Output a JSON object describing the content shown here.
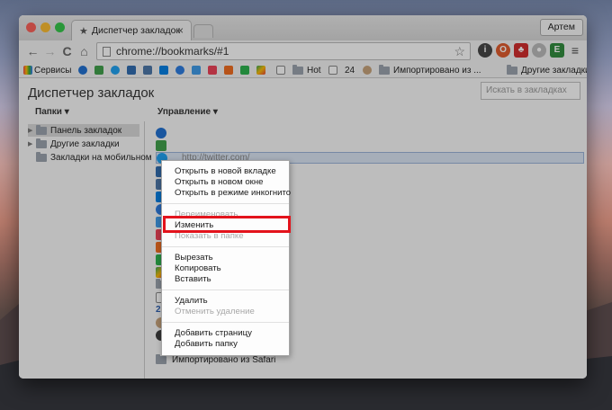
{
  "browser": {
    "tab_title": "Диспетчер закладок",
    "profile": "Артем",
    "url": "chrome://bookmarks/#1"
  },
  "bookmarks_bar": {
    "services": "Сервисы",
    "hot": "Hot",
    "num": "24",
    "imported": "Импортировано из ...",
    "other": "Другие закладки"
  },
  "page": {
    "title": "Диспетчер закладок",
    "search_placeholder": "Искать в закладках",
    "folders_header": "Папки ▾",
    "manage_header": "Управление ▾"
  },
  "tree": [
    {
      "label": "Панель закладок"
    },
    {
      "label": "Другие закладки"
    },
    {
      "label": "Закладки на мобильном"
    }
  ],
  "list": {
    "selected_url": "http://twitter.com/",
    "last_folder": "Импортировано из Safari",
    "partial": "2"
  },
  "context_menu": {
    "open_new_tab": "Открыть в новой вкладке",
    "open_new_window": "Открыть в новом окне",
    "open_incognito": "Открыть в режиме инкогнито",
    "rename": "Переименовать",
    "edit": "Изменить",
    "show_in_folder": "Показать в папке",
    "cut": "Вырезать",
    "copy": "Копировать",
    "paste": "Вставить",
    "delete": "Удалить",
    "undo_delete": "Отменить удаление",
    "add_page": "Добавить страницу",
    "add_folder": "Добавить папку"
  },
  "colors": {
    "highlight": "#e3131c",
    "selection": "#dbe6f5",
    "twitter": "#1da1f2"
  }
}
